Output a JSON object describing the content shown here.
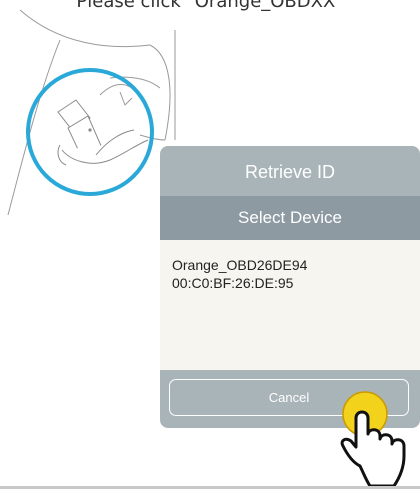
{
  "instruction": {
    "text": "Please click \"Orange_OBDXX\""
  },
  "dialog": {
    "title": "Retrieve ID",
    "subtitle": "Select Device",
    "devices": [
      {
        "name": "Orange_OBD26DE94",
        "address": "00:C0:BF:26:DE:95"
      }
    ],
    "cancel_label": "Cancel"
  },
  "colors": {
    "header": "#a9b4b9",
    "subheader": "#8d9aa1",
    "panel": "#f7f5ef",
    "highlight_circle": "#2aa9d8",
    "tap_indicator": "#f2d21b"
  },
  "icons": {
    "obd_device": "obd-adapter-illustration",
    "tap_hand": "pointing-hand-icon"
  }
}
